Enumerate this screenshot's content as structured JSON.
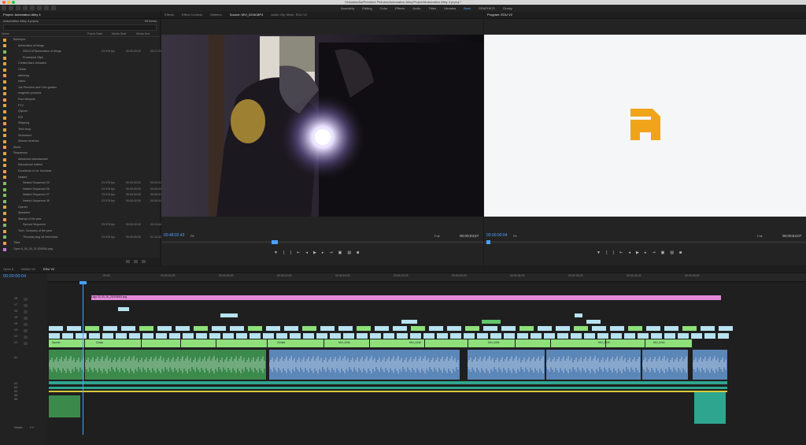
{
  "window": {
    "title": "/Volumes/Aa/Premiere Pictures/Automation Alley/Project/Automation Alley 4.prproj *"
  },
  "workspaces": [
    {
      "label": "Assembly",
      "active": false
    },
    {
      "label": "Editing",
      "active": false
    },
    {
      "label": "Color",
      "active": false
    },
    {
      "label": "Effects",
      "active": false
    },
    {
      "label": "Audio",
      "active": false
    },
    {
      "label": "Titles",
      "active": false
    },
    {
      "label": "Libraries",
      "active": false
    },
    {
      "label": "Brad",
      "active": true
    },
    {
      "label": "GRAPHICS",
      "active": false
    },
    {
      "label": "Clunky",
      "active": false
    }
  ],
  "project": {
    "tab": "Project: Automation Alley 4",
    "name": "Automation Alley 4.prproj",
    "count": "99 Items",
    "columns": [
      "Name",
      "Frame Rate",
      "Media Start",
      "Media End"
    ],
    "rows": [
      {
        "indent": 1,
        "name": "Bullseyes",
        "color": "#e9a13a",
        "fr": "",
        "st": "",
        "en": ""
      },
      {
        "indent": 2,
        "name": "Automation of things",
        "color": "#e9a13a",
        "fr": "",
        "st": "",
        "en": ""
      },
      {
        "indent": 3,
        "name": "00014 MTAutomation of things",
        "color": "#7ac060",
        "fr": "23.976 fps",
        "st": "00:00:00:00",
        "en": "00:17:21:12"
      },
      {
        "indent": 3,
        "name": "Processed Clips",
        "color": "#e9a13a",
        "fr": "",
        "st": "",
        "en": ""
      },
      {
        "indent": 2,
        "name": "Christa Mare-reloaded",
        "color": "#e9a13a",
        "fr": "",
        "st": "",
        "en": ""
      },
      {
        "indent": 2,
        "name": "Cintas",
        "color": "#e9a13a",
        "fr": "",
        "st": "",
        "en": ""
      },
      {
        "indent": 2,
        "name": "admiring",
        "color": "#e9a13a",
        "fr": "",
        "st": "",
        "en": ""
      },
      {
        "indent": 2,
        "name": "Intero",
        "color": "#e9a13a",
        "fr": "",
        "st": "",
        "en": ""
      },
      {
        "indent": 2,
        "name": "Joe Pernumo and ViVo garden",
        "color": "#e9a13a",
        "fr": "",
        "st": "",
        "en": ""
      },
      {
        "indent": 2,
        "name": "magnetic products",
        "color": "#e9a13a",
        "fr": "",
        "st": "",
        "en": ""
      },
      {
        "indent": 2,
        "name": "Paul Mespole",
        "color": "#e9a13a",
        "fr": "",
        "st": "",
        "en": ""
      },
      {
        "indent": 2,
        "name": "PTC",
        "color": "#e9a13a",
        "fr": "",
        "st": "",
        "en": ""
      },
      {
        "indent": 2,
        "name": "Qiyuom",
        "color": "#e9a13a",
        "fr": "",
        "st": "",
        "en": ""
      },
      {
        "indent": 2,
        "name": "RGI",
        "color": "#e9a13a",
        "fr": "",
        "st": "",
        "en": ""
      },
      {
        "indent": 2,
        "name": "Shipping",
        "color": "#e9a13a",
        "fr": "",
        "st": "",
        "en": ""
      },
      {
        "indent": 2,
        "name": "Tech shop",
        "color": "#e9a13a",
        "fr": "",
        "st": "",
        "en": ""
      },
      {
        "indent": 2,
        "name": "Vectorform",
        "color": "#e9a13a",
        "fr": "",
        "st": "",
        "en": ""
      },
      {
        "indent": 2,
        "name": "Women America",
        "color": "#e9a13a",
        "fr": "",
        "st": "",
        "en": ""
      },
      {
        "indent": 1,
        "name": "Music",
        "color": "#e9a13a",
        "fr": "",
        "st": "",
        "en": ""
      },
      {
        "indent": 1,
        "name": "Sequences",
        "color": "#e9a13a",
        "fr": "",
        "st": "",
        "en": ""
      },
      {
        "indent": 2,
        "name": "Advanced manufacturer",
        "color": "#e9a13a",
        "fr": "",
        "st": "",
        "en": ""
      },
      {
        "indent": 2,
        "name": "Educational institue",
        "color": "#e9a13a",
        "fr": "",
        "st": "",
        "en": ""
      },
      {
        "indent": 2,
        "name": "Excellence in Int. business",
        "color": "#e9a13a",
        "fr": "",
        "st": "",
        "en": ""
      },
      {
        "indent": 2,
        "name": "Nested",
        "color": "#e9a13a",
        "fr": "",
        "st": "",
        "en": ""
      },
      {
        "indent": 3,
        "name": "Nested Sequence 03",
        "color": "#7ac060",
        "fr": "23.976 fps",
        "st": "00:00:00:00",
        "en": "00:00:01:06"
      },
      {
        "indent": 3,
        "name": "Nested Sequence 06",
        "color": "#7ac060",
        "fr": "23.976 fps",
        "st": "00:00:00:00",
        "en": "00:00:02:03"
      },
      {
        "indent": 3,
        "name": "Nested Sequence 07",
        "color": "#7ac060",
        "fr": "23.976 fps",
        "st": "00:00:00:00",
        "en": "00:00:01:20"
      },
      {
        "indent": 3,
        "name": "Nested Sequence 08",
        "color": "#7ac060",
        "fr": "23.976 fps",
        "st": "00:00:00:00",
        "en": "00:00:01:13"
      },
      {
        "indent": 2,
        "name": "Opener",
        "color": "#e9a13a",
        "fr": "",
        "st": "",
        "en": ""
      },
      {
        "indent": 2,
        "name": "Speakers",
        "color": "#e9a13a",
        "fr": "",
        "st": "",
        "en": ""
      },
      {
        "indent": 2,
        "name": "Startup of the year",
        "color": "#e9a13a",
        "fr": "",
        "st": "",
        "en": ""
      },
      {
        "indent": 3,
        "name": "Synced Sequence",
        "color": "#7ac060",
        "fr": "23.976 fps",
        "st": "00:00:00:00",
        "en": "00:13:04:01"
      },
      {
        "indent": 2,
        "name": "Tech. Company of the year",
        "color": "#e9a13a",
        "fr": "",
        "st": "",
        "en": ""
      },
      {
        "indent": 3,
        "name": "Thursday Aug 18 Interviews",
        "color": "#7ac060",
        "fr": "23.976 fps",
        "st": "00:00:00:00",
        "en": "01:12:40:21"
      },
      {
        "indent": 1,
        "name": "Titles",
        "color": "#e9a13a",
        "fr": "",
        "st": "",
        "en": ""
      },
      {
        "indent": 1,
        "name": "Open 0_00_04_21.000000.png",
        "color": "#c77ad4",
        "fr": "",
        "st": "",
        "en": ""
      }
    ]
  },
  "source": {
    "tabs": [
      {
        "label": "Effects",
        "on": false
      },
      {
        "label": "Effect Controls",
        "on": false
      },
      {
        "label": "Markers",
        "on": false
      },
      {
        "label": "Source: MVI_0246.MP4",
        "on": true
      },
      {
        "label": "Audio Clip Mixer: EDU V2",
        "on": false
      }
    ],
    "timecode_left": "00:48:02:43",
    "fit": "Fit",
    "quality": "Full",
    "timecode_right": "00;00;03;57"
  },
  "program": {
    "tab": "Program: EDU V2",
    "timecode_left": "00:00:00:04",
    "fit": "Fit",
    "quality": "Full",
    "timecode_right": "00;00;54;07",
    "logo_color": "#f0a41a"
  },
  "timeline": {
    "tabs": [
      {
        "label": "Open 8",
        "on": false
      },
      {
        "label": "MANU V2",
        "on": false
      },
      {
        "label": "EDU V2",
        "on": true
      }
    ],
    "timecode": "00:00:00:04",
    "ruler": [
      ":00:00",
      "00:00:04:23",
      "00:00:09:23",
      "00:00:14:23",
      "00:00:19:23",
      "00:00:24:23",
      "00:00:29:23",
      "00:00:34:23",
      "00:00:39:23",
      "00:00:44:23",
      "00:00:49:23"
    ],
    "video_tracks": [
      "V8",
      "V7",
      "V6",
      "V5",
      "V4",
      "V3",
      "V2",
      "V1"
    ],
    "audio_tracks": [
      "A1",
      "A2",
      "A3",
      "A4",
      "A5",
      "A6"
    ],
    "master_label": "Master",
    "master_value": "0.0",
    "logo_clip": "Logo 00_00_00_25.000000.png",
    "v1_labels": [
      "Opener",
      "Cintas",
      "Christa",
      "MVI_0246",
      "MVI_0248",
      "MVI_9254",
      "MVI_0249",
      "MVI_0244"
    ],
    "colors": {
      "video": "#8fe07a",
      "video_blue": "#b7e2f0",
      "logo": "#e28ad8",
      "audio_green": "#3b8a4c",
      "audio_blue": "#5b86b8",
      "teal": "#2ea58f",
      "yellow": "#d9c93a"
    }
  }
}
